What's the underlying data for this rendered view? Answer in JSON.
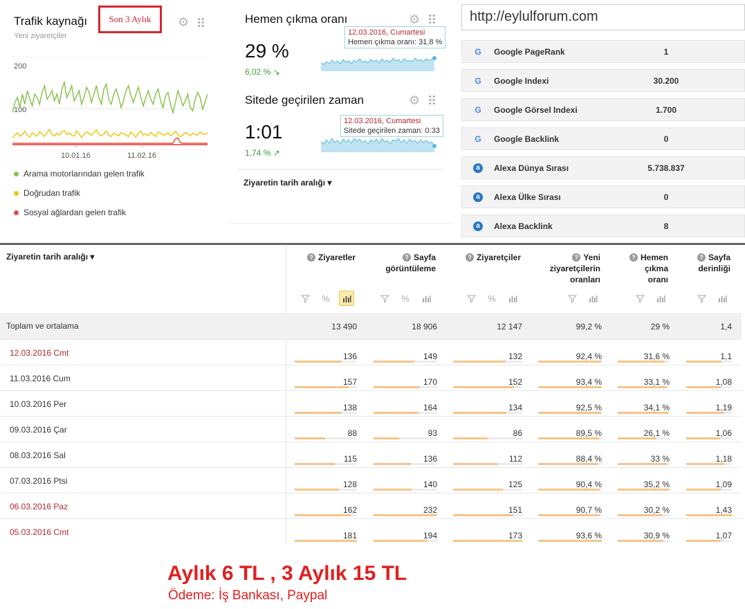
{
  "traffic": {
    "title": "Trafik kaynağı",
    "subtitle": "Yeni ziyaretçiler",
    "period_button": "Son 3 Aylık",
    "chart_data": {
      "type": "line",
      "x_ticks": [
        "10.01.16",
        "11.02.16"
      ],
      "y_ticks": [
        "200",
        "100"
      ],
      "ylim": [
        0,
        240
      ],
      "series": [
        {
          "name": "Arama motorlarından gelen trafik",
          "color": "#8cc152",
          "values": [
            95,
            125,
            140,
            110,
            150,
            120,
            160,
            135,
            115,
            150,
            140,
            120,
            155,
            175,
            135,
            145,
            160,
            130,
            150,
            120,
            165,
            185,
            140,
            155,
            175,
            130,
            145,
            160,
            120,
            140,
            170,
            155,
            125,
            150,
            175,
            140,
            120,
            165,
            180,
            135,
            120,
            150,
            165,
            140,
            110,
            130,
            160,
            175,
            145,
            125,
            150,
            170,
            140,
            115,
            140,
            160,
            135,
            120,
            150,
            165,
            130,
            110,
            145,
            155,
            120,
            95,
            125,
            160,
            140,
            115,
            130,
            150,
            110,
            100,
            135,
            155,
            140,
            105,
            125,
            150
          ]
        },
        {
          "name": "Doğrudan trafik",
          "color": "#f1c40f",
          "values": [
            20,
            28,
            35,
            25,
            30,
            40,
            28,
            22,
            35,
            30,
            25,
            38,
            32,
            24,
            36,
            45,
            30,
            26,
            34,
            28,
            38,
            42,
            30,
            35,
            28,
            25,
            40,
            32,
            22,
            30,
            38,
            34,
            28,
            36,
            44,
            30,
            26,
            32,
            40,
            28,
            24,
            34,
            30,
            26,
            36,
            32,
            28,
            24,
            38,
            30,
            22,
            34,
            40,
            28,
            32,
            26,
            36,
            30,
            24,
            38,
            34,
            28,
            30,
            36,
            26,
            32,
            40,
            30,
            24,
            28,
            36,
            32,
            26,
            34,
            30,
            28,
            38,
            32,
            30,
            36
          ]
        },
        {
          "name": "Sosyal ağlardan gelen trafik",
          "color": "#e74c3c",
          "values": [
            2,
            2,
            2,
            2,
            2,
            2,
            2,
            2,
            2,
            2,
            2,
            2,
            2,
            2,
            2,
            2,
            2,
            2,
            2,
            2,
            2,
            2,
            2,
            2,
            2,
            2,
            2,
            2,
            2,
            2,
            2,
            2,
            2,
            2,
            2,
            2,
            2,
            2,
            2,
            2,
            2,
            2,
            2,
            2,
            2,
            2,
            2,
            2,
            2,
            2,
            2,
            2,
            2,
            2,
            2,
            2,
            2,
            2,
            2,
            2,
            2,
            2,
            2,
            2,
            2,
            2,
            15,
            18,
            4,
            2,
            2,
            2,
            2,
            2,
            2,
            2,
            2,
            2,
            2,
            2
          ]
        }
      ]
    },
    "legend": [
      {
        "label": "Arama motorlarından gelen trafik",
        "color": "#8cc152"
      },
      {
        "label": "Doğrudan trafik",
        "color": "#f1c40f"
      },
      {
        "label": "Sosyal ağlardan gelen trafik",
        "color": "#e74c3c"
      }
    ]
  },
  "bounce": {
    "title": "Hemen çıkma oranı",
    "value": "29 %",
    "delta": "6,02 % ↘",
    "tooltip_date": "12.03.2016, Cumartesi",
    "tooltip_text": "Hemen çıkma oranı: 31,8 %"
  },
  "time": {
    "title": "Sitede geçirilen zaman",
    "value": "1:01",
    "delta": "1,74 % ↗",
    "tooltip_date": "12.03.2016, Cumartesi",
    "tooltip_text": "Sitede geçirilen zaman: 0:33"
  },
  "date_range_label": "Ziyaretin tarih aralığı  ▾",
  "seo": {
    "url": "http://eylulforum.com",
    "rows": [
      {
        "icon": "google-icon",
        "label": "Google PageRank",
        "value": "1"
      },
      {
        "icon": "google-icon",
        "label": "Google Indexi",
        "value": "30.200"
      },
      {
        "icon": "google-icon",
        "label": "Google Görsel Indexi",
        "value": "1.700"
      },
      {
        "icon": "google-icon",
        "label": "Google Backlink",
        "value": "0"
      },
      {
        "icon": "alexa-icon",
        "label": "Alexa Dünya Sırası",
        "value": "5.738.837"
      },
      {
        "icon": "alexa-icon",
        "label": "Alexa Ülke Sırası",
        "value": "0"
      },
      {
        "icon": "alexa-icon",
        "label": "Alexa Backlink",
        "value": "8"
      }
    ]
  },
  "table": {
    "first_col_header": "Ziyaretin tarih aralığı  ▾",
    "columns": [
      {
        "label_lines": [
          "Ziyaretler"
        ]
      },
      {
        "label_lines": [
          "Sayfa",
          "görüntüleme"
        ]
      },
      {
        "label_lines": [
          "Ziyaretçiler"
        ]
      },
      {
        "label_lines": [
          "Yeni",
          "ziyaretçilerin",
          "oranları"
        ]
      },
      {
        "label_lines": [
          "Hemen",
          "çıkma",
          "oranı"
        ]
      },
      {
        "label_lines": [
          "Sayfa",
          "derinliği"
        ]
      }
    ],
    "total": {
      "name": "Toplam ve ortalama",
      "values": [
        "13 490",
        "18 906",
        "12 147",
        "99,2 %",
        "29 %",
        "1,4"
      ]
    },
    "rows": [
      {
        "name": "12.03.2016 Cmt",
        "weekend": true,
        "values": [
          "136",
          "149",
          "132",
          "92,4 %",
          "31,6 %",
          "1,1"
        ],
        "fill": [
          0.75,
          0.64,
          0.76,
          0.99,
          0.9,
          0.77
        ]
      },
      {
        "name": "11.03.2016 Cum",
        "weekend": false,
        "values": [
          "157",
          "170",
          "152",
          "93,4 %",
          "33,1 %",
          "1,08"
        ],
        "fill": [
          0.87,
          0.73,
          0.88,
          1.0,
          0.94,
          0.76
        ]
      },
      {
        "name": "10.03.2016 Per",
        "weekend": false,
        "values": [
          "138",
          "164",
          "134",
          "92,5 %",
          "34,1 %",
          "1,19"
        ],
        "fill": [
          0.76,
          0.71,
          0.77,
          0.99,
          0.97,
          0.83
        ]
      },
      {
        "name": "09.03.2016 Çar",
        "weekend": false,
        "values": [
          "88",
          "93",
          "86",
          "89,5 %",
          "26,1 %",
          "1,06"
        ],
        "fill": [
          0.49,
          0.4,
          0.5,
          0.96,
          0.74,
          0.74
        ]
      },
      {
        "name": "08.03.2016 Sal",
        "weekend": false,
        "values": [
          "115",
          "136",
          "112",
          "88,4 %",
          "33 %",
          "1,18"
        ],
        "fill": [
          0.64,
          0.59,
          0.65,
          0.94,
          0.94,
          0.83
        ]
      },
      {
        "name": "07.03.2016 Ptsi",
        "weekend": false,
        "values": [
          "128",
          "140",
          "125",
          "90,4 %",
          "35,2 %",
          "1,09"
        ],
        "fill": [
          0.71,
          0.6,
          0.72,
          0.97,
          1.0,
          0.76
        ]
      },
      {
        "name": "06.03.2016 Paz",
        "weekend": true,
        "values": [
          "162",
          "232",
          "151",
          "90,7 %",
          "30,2 %",
          "1,43"
        ],
        "fill": [
          0.9,
          1.0,
          0.87,
          0.97,
          0.86,
          1.0
        ]
      },
      {
        "name": "05.03.2016 Cmt",
        "weekend": true,
        "values": [
          "181",
          "194",
          "173",
          "93,6 %",
          "30,9 %",
          "1,07"
        ],
        "fill": [
          1.0,
          0.84,
          1.0,
          1.0,
          0.88,
          0.75
        ]
      }
    ]
  },
  "promo": {
    "price": "Aylık 6 TL , 3 Aylık 15 TL",
    "payment": "Ödeme: İş Bankası, Paypal"
  }
}
